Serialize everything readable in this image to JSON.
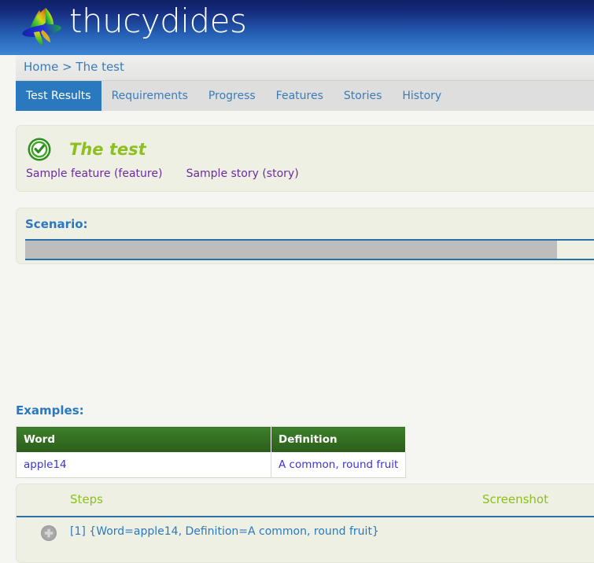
{
  "brand": {
    "name": "thucydides",
    "logo_icon": "rainbow-fan-logo"
  },
  "breadcrumb": {
    "text": "Home > The test"
  },
  "tabs": [
    {
      "label": "Test Results",
      "active": true
    },
    {
      "label": "Requirements",
      "active": false
    },
    {
      "label": "Progress",
      "active": false
    },
    {
      "label": "Features",
      "active": false
    },
    {
      "label": "Stories",
      "active": false
    },
    {
      "label": "History",
      "active": false
    }
  ],
  "test_header": {
    "status_icon": "green-check-circle-icon",
    "title": "The test",
    "tags": [
      {
        "label": "Sample feature (feature)"
      },
      {
        "label": "Sample story (story)"
      }
    ]
  },
  "scenario": {
    "label": "Scenario:",
    "selected_text": ""
  },
  "examples": {
    "label": "Examples:",
    "columns": [
      "Word",
      "Definition"
    ],
    "rows": [
      [
        "apple14",
        "A common, round fruit"
      ]
    ]
  },
  "steps": {
    "columns": {
      "steps": "Steps",
      "screenshot": "Screenshot"
    },
    "rows": [
      {
        "expand_icon": "plus-circle-icon",
        "text": "[1] {Word=apple14, Definition=A common, round fruit}"
      }
    ]
  },
  "colors": {
    "banner_top": "#0f2163",
    "banner_bottom": "#3d86d4",
    "tab_active_bg": "#2a79be",
    "link_blue": "#3b7cb8",
    "title_green": "#8dbf1f",
    "tag_purple": "#6c2ba0",
    "table_header_green": "#3c7f29",
    "cell_text_blue": "#3b35d4",
    "panel_bg": "#eef0e4",
    "page_bg": "#f5f6f1"
  }
}
